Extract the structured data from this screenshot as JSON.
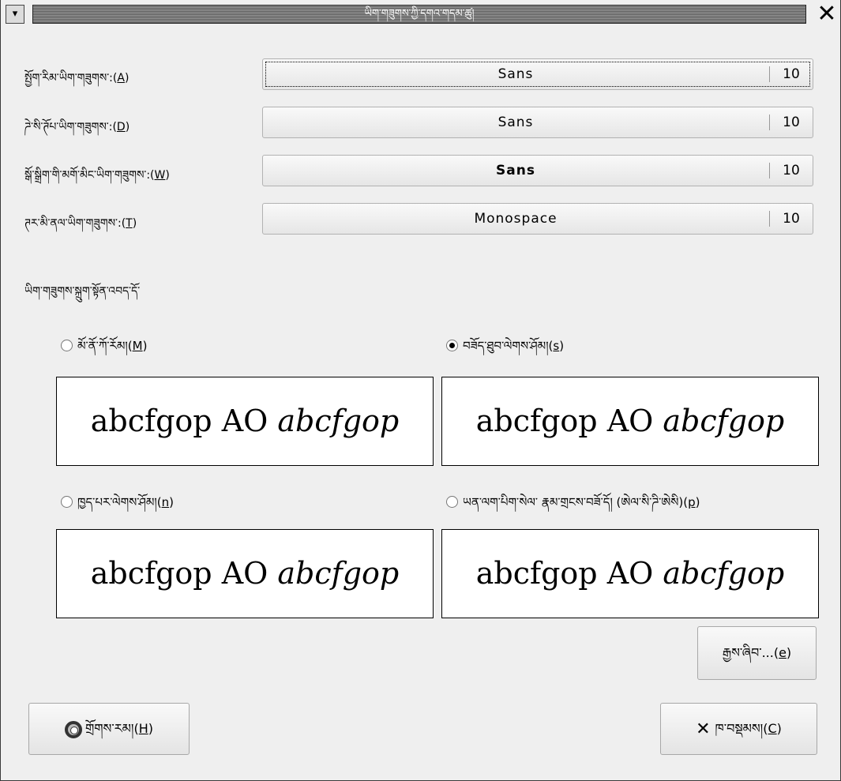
{
  "window": {
    "title": "ཡིག་གཟུགས་ཀྱི་དགའ་གདམ་ཚུ།",
    "menu_glyph": "▾",
    "close_glyph": "✕"
  },
  "font_rows": [
    {
      "label": "སྤྱོག་རིམ་ཡིག་གཟུགས་:(",
      "mnemonic": "A",
      "close": ")",
      "font": "Sans",
      "size": "10"
    },
    {
      "label": "ཌེ་སི་ཊོཔ་ཡིག་གཟུགས་:(",
      "mnemonic": "D",
      "close": ")",
      "font": "Sans",
      "size": "10"
    },
    {
      "label": "སྒོ་སྒྲིག་གི་མགོ་མིང་ཡིག་གཟུགས་:(",
      "mnemonic": "W",
      "close": ")",
      "font": "Sans",
      "size": "10"
    },
    {
      "label": "ཊར་མི་ནལ་ཡིག་གཟུགས་:(",
      "mnemonic": "T",
      "close": ")",
      "font": "Monospace",
      "size": "10"
    }
  ],
  "rendering": {
    "heading": "ཡིག་གཟུགས་སྐྲུག་སྟོན་འབད་དོ་",
    "options": [
      {
        "label": "མོ་ནོ་ཀོ་རོམ།(",
        "mnemonic": "M",
        "close": ")",
        "checked": false
      },
      {
        "label": "བཟོད་ཐུབ་ལེགས་ཤོམ།(",
        "mnemonic": "s",
        "close": ")",
        "checked": true
      },
      {
        "label": "ཁྱད་པར་ལེགས་ཤོམ།(",
        "mnemonic": "n",
        "close": ")",
        "checked": false
      },
      {
        "label": "ཡན་ལག་པིག་སེལ་ རྣམ་གྲངས་བཟོ་དོ། (ཨེལ་སི་ཌི་ཨེསི)(",
        "mnemonic": "p",
        "close": ")",
        "checked": false
      }
    ],
    "preview": {
      "regular": "abcfgop AO ",
      "italic": "abcfgop"
    }
  },
  "buttons": {
    "details_label": "རྒྱས་ཞིབ་...(",
    "details_mnemonic": "e",
    "details_close": ")",
    "help_label": "གྲོགས་རམ།(",
    "help_mnemonic": "H",
    "help_close": ")",
    "cancel_label": "ཁ་བསྡམས།(",
    "cancel_mnemonic": "C",
    "cancel_close": ")",
    "cancel_glyph": "✕"
  }
}
